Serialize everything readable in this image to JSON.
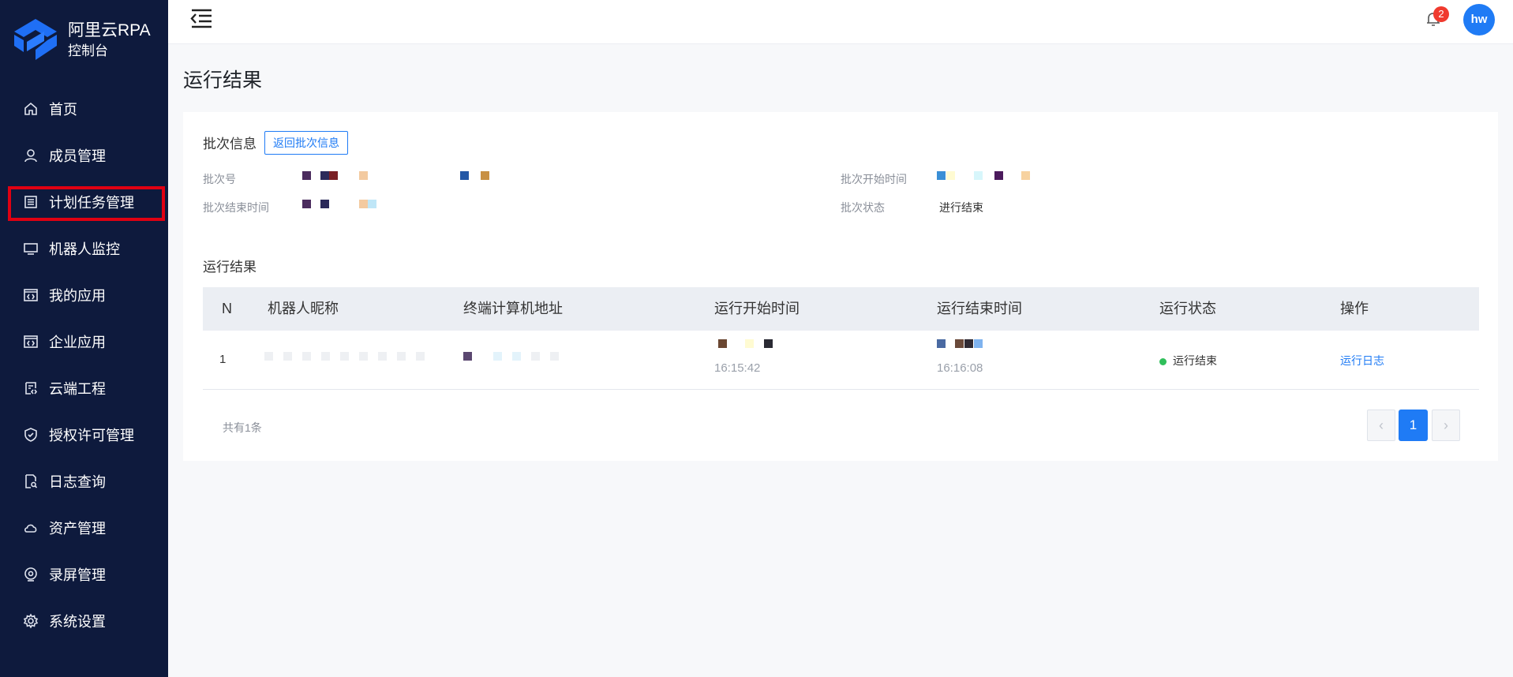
{
  "brand": {
    "name": "阿里云RPA",
    "sub": "控制台",
    "color": "#1f6ff5"
  },
  "sidebar": {
    "items": [
      {
        "label": "首页",
        "icon": "home-icon"
      },
      {
        "label": "成员管理",
        "icon": "user-icon"
      },
      {
        "label": "计划任务管理",
        "icon": "list-icon"
      },
      {
        "label": "机器人监控",
        "icon": "monitor-icon"
      },
      {
        "label": "我的应用",
        "icon": "code-window-icon"
      },
      {
        "label": "企业应用",
        "icon": "code-window-icon"
      },
      {
        "label": "云端工程",
        "icon": "cloud-project-icon"
      },
      {
        "label": "授权许可管理",
        "icon": "shield-check-icon"
      },
      {
        "label": "日志查询",
        "icon": "log-search-icon"
      },
      {
        "label": "资产管理",
        "icon": "cloud-icon"
      },
      {
        "label": "录屏管理",
        "icon": "record-icon"
      },
      {
        "label": "系统设置",
        "icon": "gear-icon"
      }
    ]
  },
  "header": {
    "notification_count": "2",
    "avatar_text": "hw"
  },
  "page": {
    "title": "运行结果"
  },
  "batch": {
    "section_title": "批次信息",
    "back_button": "返回批次信息",
    "labels": {
      "batch_no": "批次号",
      "start_time": "批次开始时间",
      "end_time": "批次结束时间",
      "status": "批次状态"
    },
    "status_value": "进行结束"
  },
  "results": {
    "section_title": "运行结果",
    "columns": [
      "N",
      "机器人昵称",
      "终端计算机地址",
      "运行开始时间",
      "运行结束时间",
      "运行状态",
      "操作"
    ],
    "rows": [
      {
        "n": "1",
        "start_time": "16:15:42",
        "end_time": "16:16:08",
        "status": "运行结束",
        "action": "运行日志"
      }
    ],
    "total": "共有1条",
    "current_page": "1"
  },
  "colors": {
    "accent": "#1f7bf5",
    "sidebar_bg": "#0e1a3d",
    "highlight_border": "#e00012",
    "status_ok": "#2fbf5a"
  }
}
